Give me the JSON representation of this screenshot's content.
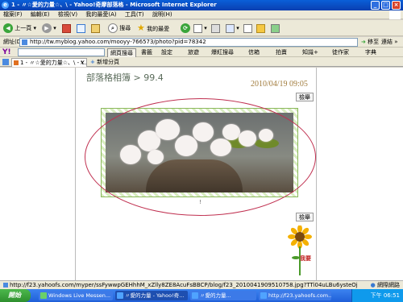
{
  "window": {
    "title": "1 - 〃☆愛的力量☆、\\ - Yahoo!奇摩部落格 - Microsoft Internet Explorer"
  },
  "menu": [
    "檔案(F)",
    "編輯(E)",
    "檢視(V)",
    "我的最愛(A)",
    "工具(T)",
    "說明(H)"
  ],
  "toolbar": {
    "back": "上一頁",
    "search": "搜尋",
    "favorites": "我的最愛"
  },
  "address": {
    "label": "網址(D)",
    "url": "http://tw.myblog.yahoo.com/mooyy-766573/photo?pid=78342",
    "go": "移至",
    "links": "連結"
  },
  "yahoo_bar": {
    "logo": "Y!",
    "search_button": "網頁搜尋",
    "items": [
      "書籤",
      "設定",
      "旅遊",
      "爆紅搜尋",
      "信箱",
      "拍賣",
      "知識+",
      "徒作家",
      "字典"
    ]
  },
  "tabs": {
    "active": "1 - 〃☆愛的力量☆、\\ - Y...",
    "new_tab": "新增分頁"
  },
  "page": {
    "title": "部落格相簿 > 99.4",
    "date": "2010/04/19 09:05",
    "category_top": "檢舉",
    "category_bottom": "檢舉",
    "caption": "!",
    "sunflower_text": "我要"
  },
  "status": {
    "url": "http://f23.yahoofs.com/myper/ssFywwpGEHhhM_xZlly8ZE8AcuFsBBCP/blog/f23_2010041909510758.jpg?TTi04uLBu6ysteOj",
    "zone": "網際網路"
  },
  "taskbar": {
    "start": "開始",
    "tasks": [
      "Windows Live Messen...",
      "〃愛的力量 - Yahoo!奇...",
      "〃愛的力量...",
      "http://f23.yahoofs.com..."
    ],
    "clock": "下午 06:51"
  }
}
